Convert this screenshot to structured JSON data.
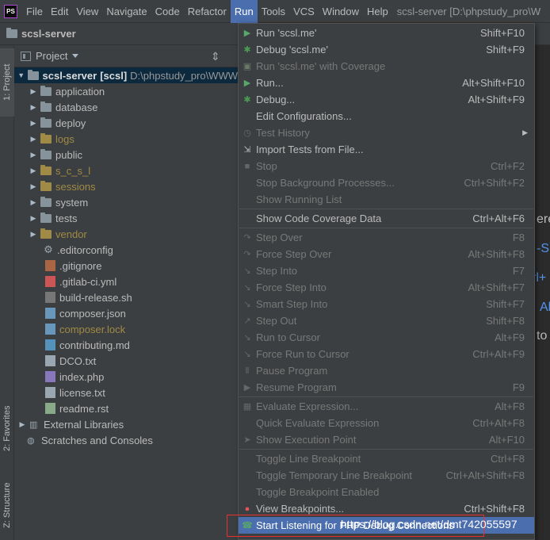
{
  "menubar": {
    "logo": "PS",
    "items": [
      "File",
      "Edit",
      "View",
      "Navigate",
      "Code",
      "Refactor",
      "Run",
      "Tools",
      "VCS",
      "Window",
      "Help"
    ],
    "active_index": 6,
    "window_title": "scsl-server [D:\\phpstudy_pro\\W"
  },
  "navbar": {
    "breadcrumb": "scsl-server"
  },
  "tool_windows": {
    "project": "1: Project",
    "favorites": "2: Favorites",
    "structure": "Z: Structure"
  },
  "project_panel": {
    "title": "Project",
    "root": {
      "name": "scsl-server",
      "module": "[scsl]",
      "path": "D:\\phpstudy_pro\\WWW"
    },
    "items": [
      {
        "name": "application",
        "kind": "folder",
        "excluded": false
      },
      {
        "name": "database",
        "kind": "folder",
        "excluded": false
      },
      {
        "name": "deploy",
        "kind": "folder",
        "excluded": false
      },
      {
        "name": "logs",
        "kind": "folder",
        "excluded": true
      },
      {
        "name": "public",
        "kind": "folder",
        "excluded": false
      },
      {
        "name": "s_c_s_l",
        "kind": "folder",
        "excluded": true
      },
      {
        "name": "sessions",
        "kind": "folder",
        "excluded": true
      },
      {
        "name": "system",
        "kind": "folder",
        "excluded": false
      },
      {
        "name": "tests",
        "kind": "folder",
        "excluded": false
      },
      {
        "name": "vendor",
        "kind": "folder",
        "excluded": true
      },
      {
        "name": ".editorconfig",
        "kind": "config",
        "excluded": false
      },
      {
        "name": ".gitignore",
        "kind": "git",
        "excluded": false
      },
      {
        "name": ".gitlab-ci.yml",
        "kind": "yml",
        "excluded": false
      },
      {
        "name": "build-release.sh",
        "kind": "sh",
        "excluded": false
      },
      {
        "name": "composer.json",
        "kind": "json",
        "excluded": false
      },
      {
        "name": "composer.lock",
        "kind": "json",
        "excluded": true
      },
      {
        "name": "contributing.md",
        "kind": "md",
        "excluded": false
      },
      {
        "name": "DCO.txt",
        "kind": "txt",
        "excluded": false
      },
      {
        "name": "index.php",
        "kind": "php",
        "excluded": false
      },
      {
        "name": "license.txt",
        "kind": "txt",
        "excluded": false
      },
      {
        "name": "readme.rst",
        "kind": "rst",
        "excluded": false
      }
    ],
    "external_libraries": "External Libraries",
    "scratches": "Scratches and Consoles"
  },
  "editor_hints": [
    "ere",
    "-Sh",
    "rl+",
    "Al",
    "to"
  ],
  "run_menu": {
    "items": [
      {
        "label": "Run 'scsl.me'",
        "shortcut": "Shift+F10",
        "enabled": true,
        "icon": "run-icon"
      },
      {
        "label": "Debug 'scsl.me'",
        "shortcut": "Shift+F9",
        "enabled": true,
        "icon": "debug-icon"
      },
      {
        "label": "Run 'scsl.me' with Coverage",
        "shortcut": "",
        "enabled": false,
        "icon": "coverage-icon"
      },
      {
        "label": "Run...",
        "shortcut": "Alt+Shift+F10",
        "enabled": true,
        "icon": "run-icon"
      },
      {
        "label": "Debug...",
        "shortcut": "Alt+Shift+F9",
        "enabled": true,
        "icon": "debug-icon"
      },
      {
        "label": "Edit Configurations...",
        "shortcut": "",
        "enabled": true,
        "icon": ""
      },
      {
        "label": "Test History",
        "shortcut": "",
        "enabled": false,
        "icon": "history-icon",
        "submenu": true
      },
      {
        "label": "Import Tests from File...",
        "shortcut": "",
        "enabled": true,
        "icon": "import-icon"
      },
      {
        "label": "Stop",
        "shortcut": "Ctrl+F2",
        "enabled": false,
        "icon": "stop-icon"
      },
      {
        "label": "Stop Background Processes...",
        "shortcut": "Ctrl+Shift+F2",
        "enabled": false,
        "icon": ""
      },
      {
        "label": "Show Running List",
        "shortcut": "",
        "enabled": false,
        "icon": ""
      },
      {
        "label": "Show Code Coverage Data",
        "shortcut": "Ctrl+Alt+F6",
        "enabled": true,
        "icon": "",
        "sep_before": true
      },
      {
        "label": "Step Over",
        "shortcut": "F8",
        "enabled": false,
        "icon": "step-over-icon",
        "sep_before": true
      },
      {
        "label": "Force Step Over",
        "shortcut": "Alt+Shift+F8",
        "enabled": false,
        "icon": "force-step-over-icon"
      },
      {
        "label": "Step Into",
        "shortcut": "F7",
        "enabled": false,
        "icon": "step-into-icon"
      },
      {
        "label": "Force Step Into",
        "shortcut": "Alt+Shift+F7",
        "enabled": false,
        "icon": "force-step-into-icon"
      },
      {
        "label": "Smart Step Into",
        "shortcut": "Shift+F7",
        "enabled": false,
        "icon": "smart-step-into-icon"
      },
      {
        "label": "Step Out",
        "shortcut": "Shift+F8",
        "enabled": false,
        "icon": "step-out-icon"
      },
      {
        "label": "Run to Cursor",
        "shortcut": "Alt+F9",
        "enabled": false,
        "icon": "run-to-cursor-icon"
      },
      {
        "label": "Force Run to Cursor",
        "shortcut": "Ctrl+Alt+F9",
        "enabled": false,
        "icon": "force-run-to-cursor-icon"
      },
      {
        "label": "Pause Program",
        "shortcut": "",
        "enabled": false,
        "icon": "pause-icon"
      },
      {
        "label": "Resume Program",
        "shortcut": "F9",
        "enabled": false,
        "icon": "resume-icon"
      },
      {
        "label": "Evaluate Expression...",
        "shortcut": "Alt+F8",
        "enabled": false,
        "icon": "evaluate-icon",
        "sep_before": true
      },
      {
        "label": "Quick Evaluate Expression",
        "shortcut": "Ctrl+Alt+F8",
        "enabled": false,
        "icon": ""
      },
      {
        "label": "Show Execution Point",
        "shortcut": "Alt+F10",
        "enabled": false,
        "icon": "execution-point-icon"
      },
      {
        "label": "Toggle Line Breakpoint",
        "shortcut": "Ctrl+F8",
        "enabled": false,
        "icon": "",
        "sep_before": true
      },
      {
        "label": "Toggle Temporary Line Breakpoint",
        "shortcut": "Ctrl+Alt+Shift+F8",
        "enabled": false,
        "icon": ""
      },
      {
        "label": "Toggle Breakpoint Enabled",
        "shortcut": "",
        "enabled": false,
        "icon": ""
      },
      {
        "label": "View Breakpoints...",
        "shortcut": "Ctrl+Shift+F8",
        "enabled": true,
        "icon": "breakpoints-icon"
      },
      {
        "label": "Start Listening for PHP Debug Connections",
        "shortcut": "",
        "enabled": true,
        "icon": "listen-debug-icon",
        "highlighted": true
      }
    ]
  },
  "watermark": "https://blog.csdn.net/dmt742055597",
  "colors": {
    "accent": "#4b6eaf",
    "callout": "#e83030",
    "excluded": "#a08a45",
    "run_green": "#59a869",
    "debug_green": "#499c54"
  }
}
